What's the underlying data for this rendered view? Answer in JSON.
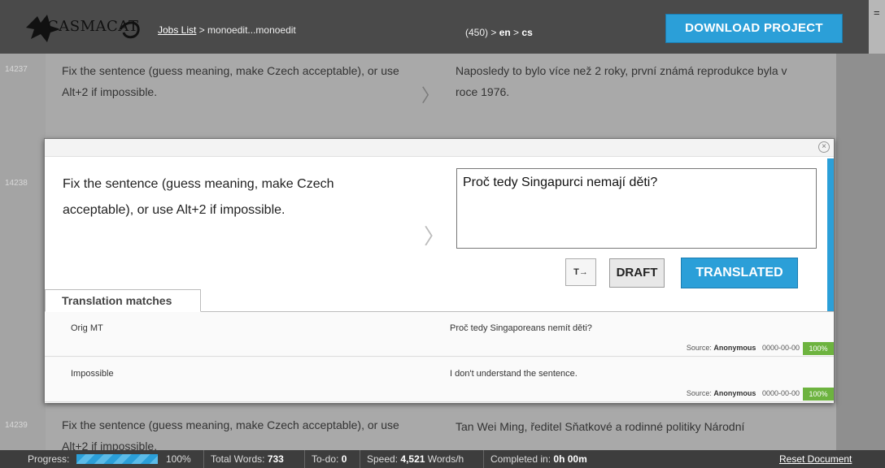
{
  "header": {
    "logo_text": "CASMACAT",
    "jobs_list_link": "Jobs List",
    "breadcrumb_rest": " > monoedit...monoedit",
    "job_count": "(450)",
    "source_lang": "en",
    "target_lang": "cs",
    "download_label": "DOWNLOAD PROJECT",
    "scroll_hint": "="
  },
  "segments": {
    "prev": {
      "number": "14237",
      "source": "Fix the sentence (guess meaning, make Czech acceptable), or use Alt+2 if impossible.",
      "target": "Naposledy to bylo více než 2 roky, první známá reprodukce byla v roce 1976."
    },
    "active": {
      "number": "14238",
      "source": "Fix the sentence (guess meaning, make Czech acceptable), or use Alt+2 if impossible.",
      "target": "Proč tedy Singapurci nemají děti?"
    },
    "next": {
      "number": "14239",
      "source": "Fix the sentence (guess meaning, make Czech acceptable), or use Alt+2 if impossible.",
      "target": "Tan Wei Ming, ředitel Sňatkové a rodinné politiky Národní"
    }
  },
  "editor": {
    "close_glyph": "×",
    "tag_button": "T→",
    "draft_button": "DRAFT",
    "translated_button": "TRANSLATED",
    "tab_label": "Translation matches",
    "matches": [
      {
        "label": "Orig MT",
        "text": "Proč tedy Singaporeans nemít děti?",
        "source_label": "Source:",
        "source_name": "Anonymous",
        "date": "0000-00-00",
        "score": "100%"
      },
      {
        "label": "Impossible",
        "text": "I don't understand the sentence.",
        "source_label": "Source:",
        "source_name": "Anonymous",
        "date": "0000-00-00",
        "score": "100%"
      }
    ]
  },
  "status": {
    "progress_label": "Progress:",
    "progress_value": 100,
    "progress_text": "100%",
    "total_words_label": "Total Words:",
    "total_words": "733",
    "todo_label": "To-do:",
    "todo": "0",
    "speed_label": "Speed:",
    "speed": "4,521",
    "speed_unit": "Words/h",
    "completed_label": "Completed in:",
    "completed": "0h 00m",
    "reset_label": "Reset Document"
  },
  "colors": {
    "accent": "#2b9fd8",
    "score_green": "#6db33f",
    "header_bg": "#4a4a4a"
  }
}
